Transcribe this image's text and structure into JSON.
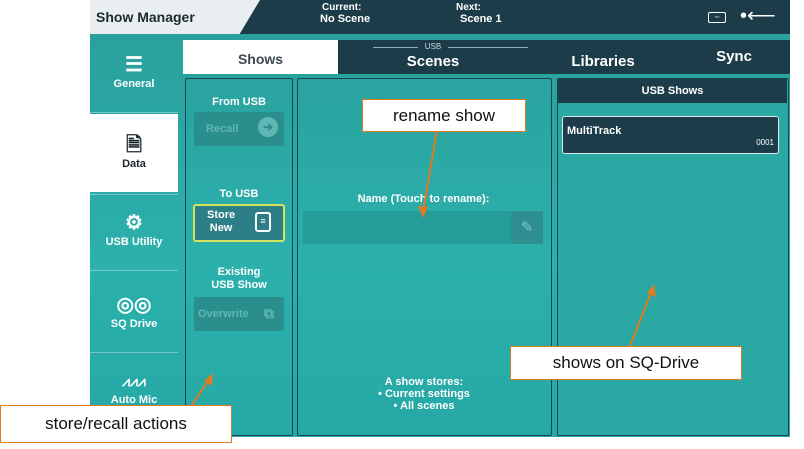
{
  "app": {
    "title": "Show Manager",
    "current_label": "Current:",
    "current_value": "No Scene",
    "next_label": "Next:",
    "next_value": "Scene 1"
  },
  "nav": {
    "items": [
      {
        "label": "General",
        "icon": "list-icon"
      },
      {
        "label": "Data",
        "icon": "usb-file-icon"
      },
      {
        "label": "USB Utility",
        "icon": "gear-icon"
      },
      {
        "label": "SQ Drive",
        "icon": "sq-drive-icon"
      },
      {
        "label": "Auto Mic",
        "icon": "auto-mic-icon"
      }
    ],
    "active": "Data"
  },
  "tabs": {
    "shows": "Shows",
    "usb_caption": "USB",
    "scenes": "Scenes",
    "libraries": "Libraries",
    "sync": "Sync"
  },
  "actions": {
    "from_usb": "From USB",
    "recall": "Recall",
    "to_usb": "To USB",
    "store_line1": "Store",
    "store_line2": "New",
    "existing_line1": "Existing",
    "existing_line2": "USB Show",
    "overwrite": "Overwrite"
  },
  "name_panel": {
    "label": "Name (Touch to rename):",
    "value": "",
    "footnote_line1": "A show stores:",
    "footnote_line2": "• Current settings",
    "footnote_line3": "• All scenes"
  },
  "usb_shows": {
    "header": "USB Shows",
    "items": [
      {
        "name": "MultiTrack",
        "number": "0001"
      }
    ]
  },
  "callouts": {
    "rename": "rename show",
    "drive": "shows on SQ-Drive",
    "store": "store/recall actions"
  },
  "colors": {
    "accent": "#e07a1f",
    "panel_bg": "#2bb0ac",
    "dark_bar": "#1b3c48",
    "store_border": "#d6e45c"
  }
}
